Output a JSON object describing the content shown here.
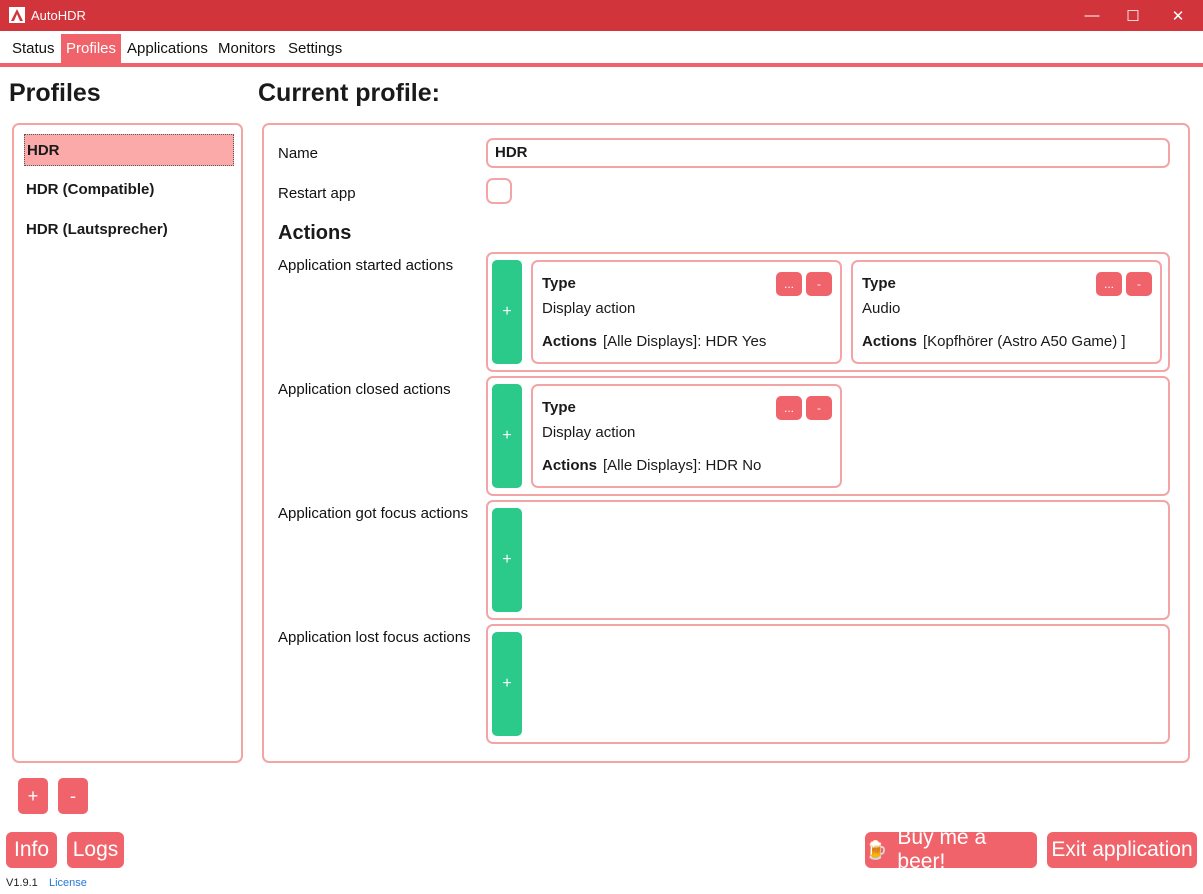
{
  "window": {
    "title": "AutoHDR",
    "app_icon": "autohdr-logo-icon",
    "minimize": "—",
    "maximize": "☐",
    "close": "✕"
  },
  "colors": {
    "accent": "#f1636a",
    "titlebar": "#d1343a",
    "border": "#f3a5a6",
    "add": "#2bc98a",
    "selected": "#fca9aa",
    "link": "#2778d4"
  },
  "tabs": [
    {
      "label": "Status"
    },
    {
      "label": "Profiles",
      "active": true
    },
    {
      "label": "Applications"
    },
    {
      "label": "Monitors"
    },
    {
      "label": "Settings"
    }
  ],
  "profiles": {
    "heading": "Profiles",
    "items": [
      {
        "label": "HDR",
        "selected": true
      },
      {
        "label": "HDR (Compatible)"
      },
      {
        "label": "HDR (Lautsprecher)"
      }
    ],
    "add_label": "+",
    "remove_label": "-"
  },
  "current_profile": {
    "heading": "Current profile:",
    "name_label": "Name",
    "name_value": "HDR",
    "restart_label": "Restart app",
    "restart_checked": false,
    "actions_heading": "Actions",
    "groups": [
      {
        "label": "Application started actions",
        "add_label": "+",
        "cards": [
          {
            "type_label": "Type",
            "type_value": "Display action",
            "actions_label": "Actions",
            "actions_value": "[Alle Displays]: HDR Yes",
            "edit_label": "...",
            "remove_label": "-"
          },
          {
            "type_label": "Type",
            "type_value": "Audio",
            "actions_label": "Actions",
            "actions_value": "[Kopfhörer (Astro A50 Game) ]",
            "edit_label": "...",
            "remove_label": "-"
          }
        ]
      },
      {
        "label": "Application closed actions",
        "add_label": "+",
        "cards": [
          {
            "type_label": "Type",
            "type_value": "Display action",
            "actions_label": "Actions",
            "actions_value": "[Alle Displays]: HDR No",
            "edit_label": "...",
            "remove_label": "-"
          }
        ]
      },
      {
        "label": "Application got focus actions",
        "add_label": "+",
        "cards": []
      },
      {
        "label": "Application lost focus actions",
        "add_label": "+",
        "cards": []
      }
    ]
  },
  "footer": {
    "info_label": "Info",
    "logs_label": "Logs",
    "beer_label": "Buy me a beer!",
    "beer_icon": "🍺",
    "exit_label": "Exit application",
    "version": "V1.9.1",
    "license_label": "License"
  }
}
